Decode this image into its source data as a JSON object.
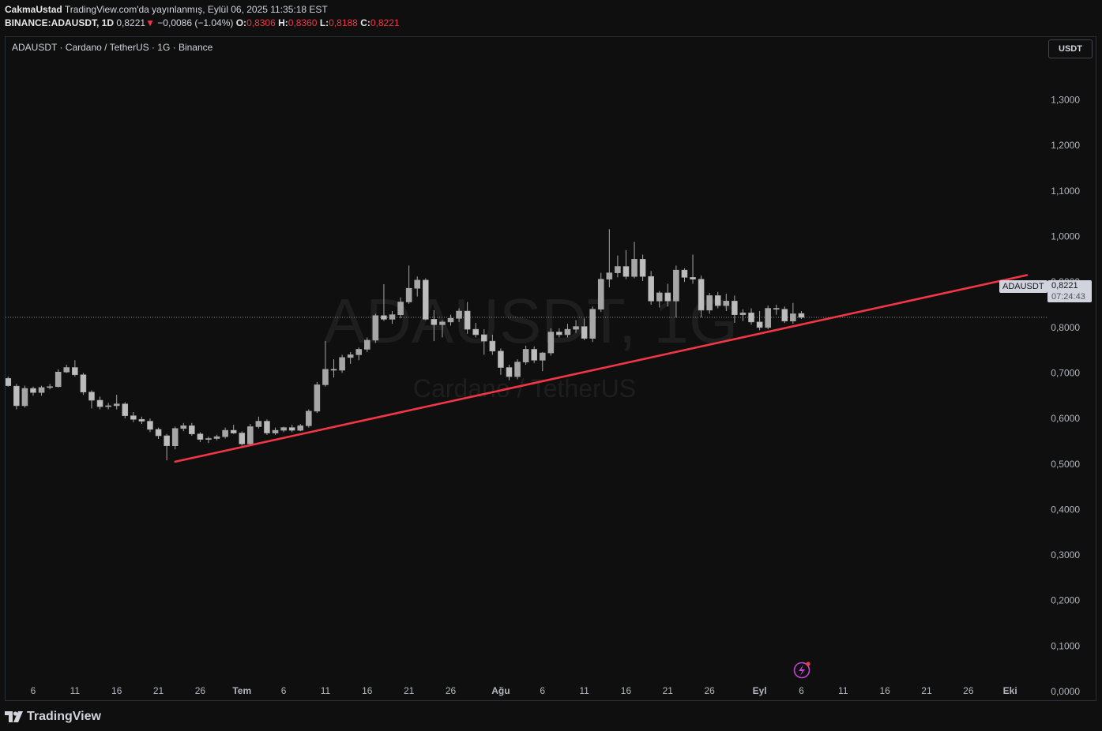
{
  "header": {
    "author": "CakmaUstad",
    "published": "TradingView.com'da yayınlanmış, Eylül 06, 2025 11:35:18 EST",
    "symbol": "BINANCE:ADAUSDT, 1D",
    "last": "0,8221",
    "change_arrow": "▼",
    "change": "−0,0086 (−1.04%)",
    "o_label": "O:",
    "o": "0,8306",
    "h_label": "H:",
    "h": "0,8360",
    "l_label": "L:",
    "l": "0,8188",
    "c_label": "C:",
    "c": "0,8221"
  },
  "chart_title": "ADAUSDT · Cardano / TetherUS · 1G · Binance",
  "currency_button": "USDT",
  "watermark": {
    "symbol": "ADAUSDT, 1G",
    "name": "Cardano / TetherUS"
  },
  "price_tag": {
    "symbol": "ADAUSDT",
    "value": "0,8221",
    "countdown": "07:24:43"
  },
  "footer": {
    "brand": "TradingView"
  },
  "colors": {
    "background": "#0f0f0f",
    "candle_body": "#a6a6a6",
    "trendline": "#f23645",
    "axis_text": "#b2b5be",
    "down_text": "#f23645",
    "lightning": "#c045d6"
  },
  "chart_data": {
    "type": "candlestick",
    "y_axis": {
      "ticks": [
        "1,3000",
        "1,2000",
        "1,1000",
        "1,0000",
        "0,9000",
        "0,8000",
        "0,7000",
        "0,6000",
        "0,5000",
        "0,4000",
        "0,3000",
        "0,2000",
        "0,1000",
        "0,0000"
      ],
      "tick_values": [
        1.3,
        1.2,
        1.1,
        1.0,
        0.9,
        0.8,
        0.7,
        0.6,
        0.5,
        0.4,
        0.3,
        0.2,
        0.1,
        0.0
      ],
      "ylim": [
        0,
        1.3
      ]
    },
    "x_axis": {
      "ticks": [
        "6",
        "11",
        "16",
        "21",
        "26",
        "Tem",
        "6",
        "11",
        "16",
        "21",
        "26",
        "Ağu",
        "6",
        "11",
        "16",
        "21",
        "26",
        "Eyl",
        "6",
        "11",
        "16",
        "21",
        "26",
        "Eki"
      ],
      "tick_dates": [
        "2025-06-06",
        "2025-06-11",
        "2025-06-16",
        "2025-06-21",
        "2025-06-26",
        "2025-07-01",
        "2025-07-06",
        "2025-07-11",
        "2025-07-16",
        "2025-07-21",
        "2025-07-26",
        "2025-08-01",
        "2025-08-06",
        "2025-08-11",
        "2025-08-16",
        "2025-08-21",
        "2025-08-26",
        "2025-09-01",
        "2025-09-06",
        "2025-09-11",
        "2025-09-16",
        "2025-09-21",
        "2025-09-26",
        "2025-10-01"
      ]
    },
    "candles": [
      {
        "date": "2025-06-01",
        "o": 0.692,
        "h": 0.708,
        "l": 0.678,
        "c": 0.682
      },
      {
        "date": "2025-06-02",
        "o": 0.682,
        "h": 0.7,
        "l": 0.671,
        "c": 0.688
      },
      {
        "date": "2025-06-03",
        "o": 0.688,
        "h": 0.692,
        "l": 0.67,
        "c": 0.672
      },
      {
        "date": "2025-06-04",
        "o": 0.671,
        "h": 0.676,
        "l": 0.62,
        "c": 0.628
      },
      {
        "date": "2025-06-05",
        "o": 0.628,
        "h": 0.672,
        "l": 0.624,
        "c": 0.666
      },
      {
        "date": "2025-06-06",
        "o": 0.666,
        "h": 0.67,
        "l": 0.65,
        "c": 0.657
      },
      {
        "date": "2025-06-07",
        "o": 0.657,
        "h": 0.672,
        "l": 0.65,
        "c": 0.668
      },
      {
        "date": "2025-06-08",
        "o": 0.668,
        "h": 0.676,
        "l": 0.664,
        "c": 0.67
      },
      {
        "date": "2025-06-09",
        "o": 0.67,
        "h": 0.708,
        "l": 0.668,
        "c": 0.702
      },
      {
        "date": "2025-06-10",
        "o": 0.702,
        "h": 0.718,
        "l": 0.7,
        "c": 0.712
      },
      {
        "date": "2025-06-11",
        "o": 0.712,
        "h": 0.728,
        "l": 0.692,
        "c": 0.696
      },
      {
        "date": "2025-06-12",
        "o": 0.696,
        "h": 0.7,
        "l": 0.652,
        "c": 0.658
      },
      {
        "date": "2025-06-13",
        "o": 0.658,
        "h": 0.662,
        "l": 0.622,
        "c": 0.64
      },
      {
        "date": "2025-06-14",
        "o": 0.64,
        "h": 0.648,
        "l": 0.62,
        "c": 0.626
      },
      {
        "date": "2025-06-15",
        "o": 0.626,
        "h": 0.634,
        "l": 0.62,
        "c": 0.628
      },
      {
        "date": "2025-06-16",
        "o": 0.628,
        "h": 0.652,
        "l": 0.62,
        "c": 0.632
      },
      {
        "date": "2025-06-17",
        "o": 0.632,
        "h": 0.636,
        "l": 0.6,
        "c": 0.606
      },
      {
        "date": "2025-06-18",
        "o": 0.606,
        "h": 0.614,
        "l": 0.592,
        "c": 0.598
      },
      {
        "date": "2025-06-19",
        "o": 0.598,
        "h": 0.604,
        "l": 0.588,
        "c": 0.594
      },
      {
        "date": "2025-06-20",
        "o": 0.594,
        "h": 0.6,
        "l": 0.57,
        "c": 0.576
      },
      {
        "date": "2025-06-21",
        "o": 0.576,
        "h": 0.58,
        "l": 0.555,
        "c": 0.562
      },
      {
        "date": "2025-06-22",
        "o": 0.562,
        "h": 0.566,
        "l": 0.508,
        "c": 0.54
      },
      {
        "date": "2025-06-23",
        "o": 0.54,
        "h": 0.582,
        "l": 0.532,
        "c": 0.578
      },
      {
        "date": "2025-06-24",
        "o": 0.578,
        "h": 0.59,
        "l": 0.572,
        "c": 0.584
      },
      {
        "date": "2025-06-25",
        "o": 0.584,
        "h": 0.59,
        "l": 0.562,
        "c": 0.566
      },
      {
        "date": "2025-06-26",
        "o": 0.566,
        "h": 0.57,
        "l": 0.548,
        "c": 0.554
      },
      {
        "date": "2025-06-27",
        "o": 0.554,
        "h": 0.56,
        "l": 0.546,
        "c": 0.556
      },
      {
        "date": "2025-06-28",
        "o": 0.556,
        "h": 0.564,
        "l": 0.552,
        "c": 0.56
      },
      {
        "date": "2025-06-29",
        "o": 0.56,
        "h": 0.58,
        "l": 0.556,
        "c": 0.574
      },
      {
        "date": "2025-06-30",
        "o": 0.574,
        "h": 0.586,
        "l": 0.566,
        "c": 0.568
      },
      {
        "date": "2025-07-01",
        "o": 0.568,
        "h": 0.572,
        "l": 0.54,
        "c": 0.544
      },
      {
        "date": "2025-07-02",
        "o": 0.544,
        "h": 0.588,
        "l": 0.54,
        "c": 0.582
      },
      {
        "date": "2025-07-03",
        "o": 0.582,
        "h": 0.604,
        "l": 0.578,
        "c": 0.594
      },
      {
        "date": "2025-07-04",
        "o": 0.594,
        "h": 0.598,
        "l": 0.564,
        "c": 0.568
      },
      {
        "date": "2025-07-05",
        "o": 0.568,
        "h": 0.58,
        "l": 0.564,
        "c": 0.574
      },
      {
        "date": "2025-07-06",
        "o": 0.574,
        "h": 0.582,
        "l": 0.57,
        "c": 0.58
      },
      {
        "date": "2025-07-07",
        "o": 0.58,
        "h": 0.586,
        "l": 0.57,
        "c": 0.574
      },
      {
        "date": "2025-07-08",
        "o": 0.574,
        "h": 0.588,
        "l": 0.572,
        "c": 0.584
      },
      {
        "date": "2025-07-09",
        "o": 0.584,
        "h": 0.62,
        "l": 0.58,
        "c": 0.616
      },
      {
        "date": "2025-07-10",
        "o": 0.616,
        "h": 0.68,
        "l": 0.612,
        "c": 0.674
      },
      {
        "date": "2025-07-11",
        "o": 0.674,
        "h": 0.77,
        "l": 0.67,
        "c": 0.708
      },
      {
        "date": "2025-07-12",
        "o": 0.708,
        "h": 0.73,
        "l": 0.69,
        "c": 0.706
      },
      {
        "date": "2025-07-13",
        "o": 0.706,
        "h": 0.74,
        "l": 0.7,
        "c": 0.734
      },
      {
        "date": "2025-07-14",
        "o": 0.734,
        "h": 0.746,
        "l": 0.72,
        "c": 0.74
      },
      {
        "date": "2025-07-15",
        "o": 0.74,
        "h": 0.756,
        "l": 0.728,
        "c": 0.752
      },
      {
        "date": "2025-07-16",
        "o": 0.752,
        "h": 0.778,
        "l": 0.746,
        "c": 0.772
      },
      {
        "date": "2025-07-17",
        "o": 0.772,
        "h": 0.83,
        "l": 0.766,
        "c": 0.826
      },
      {
        "date": "2025-07-18",
        "o": 0.826,
        "h": 0.895,
        "l": 0.814,
        "c": 0.818
      },
      {
        "date": "2025-07-19",
        "o": 0.818,
        "h": 0.836,
        "l": 0.808,
        "c": 0.828
      },
      {
        "date": "2025-07-20",
        "o": 0.828,
        "h": 0.866,
        "l": 0.82,
        "c": 0.856
      },
      {
        "date": "2025-07-21",
        "o": 0.856,
        "h": 0.936,
        "l": 0.852,
        "c": 0.886
      },
      {
        "date": "2025-07-22",
        "o": 0.886,
        "h": 0.912,
        "l": 0.868,
        "c": 0.904
      },
      {
        "date": "2025-07-23",
        "o": 0.904,
        "h": 0.908,
        "l": 0.816,
        "c": 0.818
      },
      {
        "date": "2025-07-24",
        "o": 0.818,
        "h": 0.838,
        "l": 0.77,
        "c": 0.806
      },
      {
        "date": "2025-07-25",
        "o": 0.806,
        "h": 0.816,
        "l": 0.778,
        "c": 0.812
      },
      {
        "date": "2025-07-26",
        "o": 0.812,
        "h": 0.828,
        "l": 0.804,
        "c": 0.82
      },
      {
        "date": "2025-07-27",
        "o": 0.82,
        "h": 0.842,
        "l": 0.812,
        "c": 0.836
      },
      {
        "date": "2025-07-28",
        "o": 0.836,
        "h": 0.856,
        "l": 0.786,
        "c": 0.796
      },
      {
        "date": "2025-07-29",
        "o": 0.796,
        "h": 0.81,
        "l": 0.778,
        "c": 0.784
      },
      {
        "date": "2025-07-30",
        "o": 0.784,
        "h": 0.796,
        "l": 0.74,
        "c": 0.77
      },
      {
        "date": "2025-07-31",
        "o": 0.77,
        "h": 0.784,
        "l": 0.74,
        "c": 0.748
      },
      {
        "date": "2025-08-01",
        "o": 0.748,
        "h": 0.754,
        "l": 0.696,
        "c": 0.712
      },
      {
        "date": "2025-08-02",
        "o": 0.712,
        "h": 0.718,
        "l": 0.684,
        "c": 0.692
      },
      {
        "date": "2025-08-03",
        "o": 0.692,
        "h": 0.73,
        "l": 0.686,
        "c": 0.724
      },
      {
        "date": "2025-08-04",
        "o": 0.724,
        "h": 0.76,
        "l": 0.718,
        "c": 0.752
      },
      {
        "date": "2025-08-05",
        "o": 0.752,
        "h": 0.758,
        "l": 0.722,
        "c": 0.728
      },
      {
        "date": "2025-08-06",
        "o": 0.728,
        "h": 0.746,
        "l": 0.704,
        "c": 0.744
      },
      {
        "date": "2025-08-07",
        "o": 0.744,
        "h": 0.798,
        "l": 0.738,
        "c": 0.79
      },
      {
        "date": "2025-08-08",
        "o": 0.79,
        "h": 0.798,
        "l": 0.778,
        "c": 0.784
      },
      {
        "date": "2025-08-09",
        "o": 0.784,
        "h": 0.808,
        "l": 0.778,
        "c": 0.796
      },
      {
        "date": "2025-08-10",
        "o": 0.796,
        "h": 0.816,
        "l": 0.788,
        "c": 0.802
      },
      {
        "date": "2025-08-11",
        "o": 0.802,
        "h": 0.82,
        "l": 0.772,
        "c": 0.776
      },
      {
        "date": "2025-08-12",
        "o": 0.776,
        "h": 0.846,
        "l": 0.768,
        "c": 0.84
      },
      {
        "date": "2025-08-13",
        "o": 0.84,
        "h": 0.92,
        "l": 0.834,
        "c": 0.906
      },
      {
        "date": "2025-08-14",
        "o": 0.906,
        "h": 1.016,
        "l": 0.888,
        "c": 0.92
      },
      {
        "date": "2025-08-15",
        "o": 0.92,
        "h": 0.958,
        "l": 0.91,
        "c": 0.934
      },
      {
        "date": "2025-08-16",
        "o": 0.934,
        "h": 0.97,
        "l": 0.906,
        "c": 0.912
      },
      {
        "date": "2025-08-17",
        "o": 0.912,
        "h": 0.988,
        "l": 0.908,
        "c": 0.95
      },
      {
        "date": "2025-08-18",
        "o": 0.95,
        "h": 0.96,
        "l": 0.902,
        "c": 0.912
      },
      {
        "date": "2025-08-19",
        "o": 0.912,
        "h": 0.924,
        "l": 0.85,
        "c": 0.858
      },
      {
        "date": "2025-08-20",
        "o": 0.858,
        "h": 0.88,
        "l": 0.844,
        "c": 0.876
      },
      {
        "date": "2025-08-21",
        "o": 0.876,
        "h": 0.896,
        "l": 0.846,
        "c": 0.858
      },
      {
        "date": "2025-08-22",
        "o": 0.858,
        "h": 0.936,
        "l": 0.822,
        "c": 0.926
      },
      {
        "date": "2025-08-23",
        "o": 0.926,
        "h": 0.93,
        "l": 0.9,
        "c": 0.91
      },
      {
        "date": "2025-08-24",
        "o": 0.91,
        "h": 0.96,
        "l": 0.896,
        "c": 0.906
      },
      {
        "date": "2025-08-25",
        "o": 0.906,
        "h": 0.914,
        "l": 0.822,
        "c": 0.838
      },
      {
        "date": "2025-08-26",
        "o": 0.838,
        "h": 0.876,
        "l": 0.83,
        "c": 0.87
      },
      {
        "date": "2025-08-27",
        "o": 0.87,
        "h": 0.878,
        "l": 0.842,
        "c": 0.848
      },
      {
        "date": "2025-08-28",
        "o": 0.848,
        "h": 0.874,
        "l": 0.836,
        "c": 0.858
      },
      {
        "date": "2025-08-29",
        "o": 0.858,
        "h": 0.87,
        "l": 0.81,
        "c": 0.828
      },
      {
        "date": "2025-08-30",
        "o": 0.828,
        "h": 0.84,
        "l": 0.814,
        "c": 0.832
      },
      {
        "date": "2025-08-31",
        "o": 0.832,
        "h": 0.842,
        "l": 0.806,
        "c": 0.812
      },
      {
        "date": "2025-09-01",
        "o": 0.812,
        "h": 0.836,
        "l": 0.794,
        "c": 0.8
      },
      {
        "date": "2025-09-02",
        "o": 0.8,
        "h": 0.848,
        "l": 0.796,
        "c": 0.842
      },
      {
        "date": "2025-09-03",
        "o": 0.842,
        "h": 0.85,
        "l": 0.828,
        "c": 0.84
      },
      {
        "date": "2025-09-04",
        "o": 0.84,
        "h": 0.846,
        "l": 0.81,
        "c": 0.814
      },
      {
        "date": "2025-09-05",
        "o": 0.814,
        "h": 0.854,
        "l": 0.808,
        "c": 0.83
      },
      {
        "date": "2025-09-06",
        "o": 0.8306,
        "h": 0.836,
        "l": 0.8188,
        "c": 0.8221
      }
    ],
    "last_price": 0.8221,
    "trendline": {
      "color": "#f23645",
      "from": {
        "date": "2025-06-23",
        "price": 0.505
      },
      "to": {
        "date": "2025-10-03",
        "price": 0.915
      }
    }
  }
}
